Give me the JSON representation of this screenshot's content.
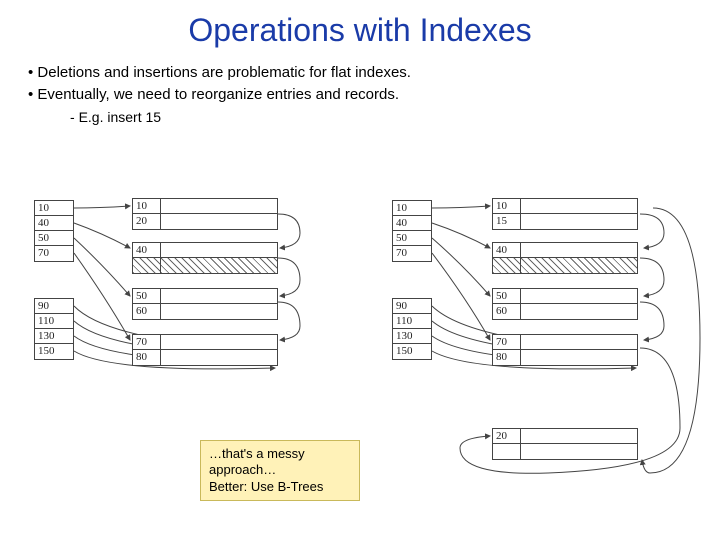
{
  "title": "Operations with Indexes",
  "bullets": [
    "Deletions and insertions are problematic for flat indexes.",
    "Eventually, we need to reorganize entries and records."
  ],
  "sub_bullet": "E.g. insert 15",
  "note": {
    "line1": "…that's a messy",
    "line2": "approach…",
    "line3": "Better: Use B-Trees"
  },
  "left": {
    "index1": [
      "10",
      "40",
      "50",
      "70"
    ],
    "index2": [
      "90",
      "110",
      "130",
      "150"
    ],
    "blocks": [
      {
        "rows": [
          "10",
          "20"
        ]
      },
      {
        "rows": [
          "40",
          ""
        ],
        "hatch_second": true
      },
      {
        "rows": [
          "50",
          "60"
        ]
      },
      {
        "rows": [
          "70",
          "80"
        ]
      }
    ]
  },
  "right": {
    "index1": [
      "10",
      "40",
      "50",
      "70"
    ],
    "index2": [
      "90",
      "110",
      "130",
      "150"
    ],
    "blocks": [
      {
        "rows": [
          "10",
          "15"
        ]
      },
      {
        "rows": [
          "40",
          ""
        ],
        "hatch_second": true
      },
      {
        "rows": [
          "50",
          "60"
        ]
      },
      {
        "rows": [
          "70",
          "80"
        ]
      },
      {
        "rows": [
          "20",
          ""
        ]
      }
    ]
  }
}
